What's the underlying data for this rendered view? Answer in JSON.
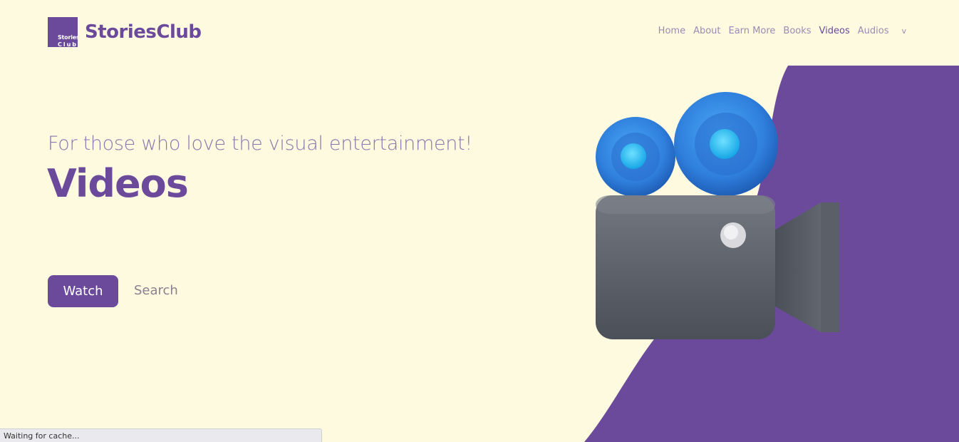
{
  "brand": {
    "logo_line1": "Stories",
    "logo_line2": "Club",
    "name": "StoriesClub"
  },
  "nav": {
    "items": [
      {
        "label": "Home",
        "active": false
      },
      {
        "label": "About",
        "active": false
      },
      {
        "label": "Earn More",
        "active": false
      },
      {
        "label": "Books",
        "active": false
      },
      {
        "label": "Videos",
        "active": true
      },
      {
        "label": "Audios",
        "active": false
      }
    ],
    "more_caret": "v"
  },
  "hero": {
    "tagline": "For those who love the visual entertainment!",
    "title": "Videos",
    "watch_label": "Watch",
    "search_label": "Search",
    "illustration_icon": "video-camera-icon"
  },
  "colors": {
    "brand_purple": "#6b4a9b",
    "background": "#fdfae0",
    "nav_text": "#9c8ab5",
    "camera_blue": "#2f86e0",
    "camera_gray": "#5e636b"
  },
  "status_bar": {
    "text": "Waiting for cache..."
  }
}
